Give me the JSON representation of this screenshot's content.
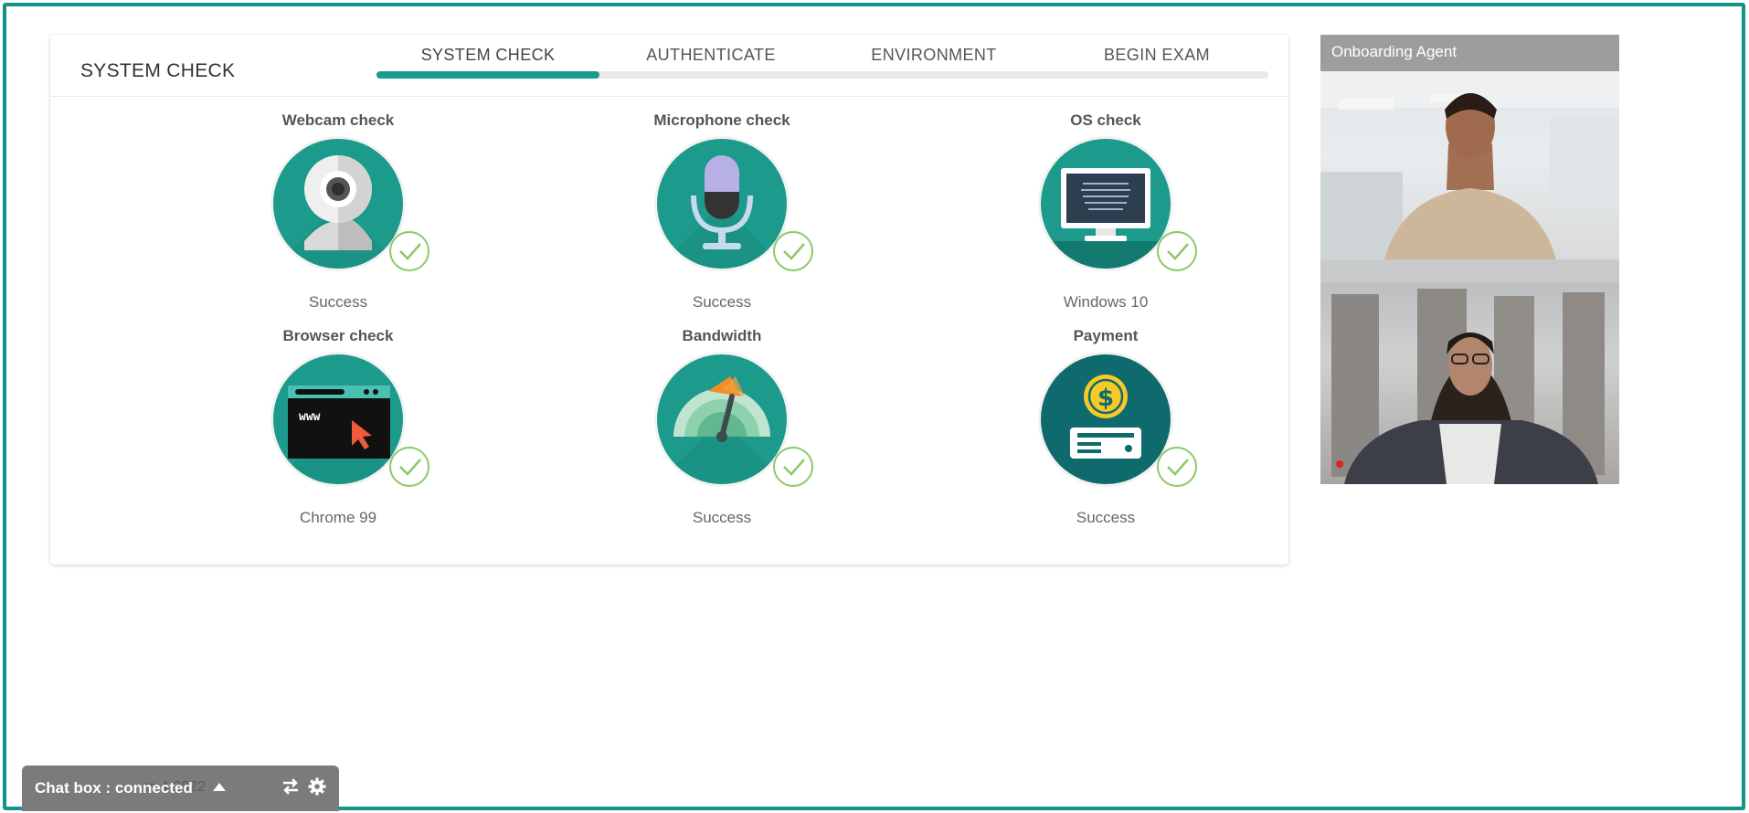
{
  "header": {
    "title": "SYSTEM CHECK",
    "steps": [
      {
        "label": "SYSTEM CHECK",
        "active": true
      },
      {
        "label": "AUTHENTICATE",
        "active": false
      },
      {
        "label": "ENVIRONMENT",
        "active": false
      },
      {
        "label": "BEGIN EXAM",
        "active": false
      }
    ],
    "progress_fraction": 0.25
  },
  "checks": [
    {
      "title": "Webcam check",
      "status": "Success",
      "icon": "webcam-icon",
      "passed": true
    },
    {
      "title": "Microphone check",
      "status": "Success",
      "icon": "microphone-icon",
      "passed": true
    },
    {
      "title": "OS check",
      "status": "Windows 10",
      "icon": "monitor-icon",
      "passed": true
    },
    {
      "title": "Browser check",
      "status": "Chrome 99",
      "icon": "browser-icon",
      "passed": true
    },
    {
      "title": "Bandwidth",
      "status": "Success",
      "icon": "speedometer-icon",
      "passed": true
    },
    {
      "title": "Payment",
      "status": "Success",
      "icon": "payment-icon",
      "passed": true
    }
  ],
  "video": {
    "label": "Onboarding Agent"
  },
  "chat": {
    "label": "Chat box : connected",
    "ghost_text": "m 4 2022"
  },
  "colors": {
    "frame": "#13938a",
    "accent": "#1a9b8e",
    "success_check": "#8cc86c",
    "chat_bar": "#7b7b7b"
  }
}
